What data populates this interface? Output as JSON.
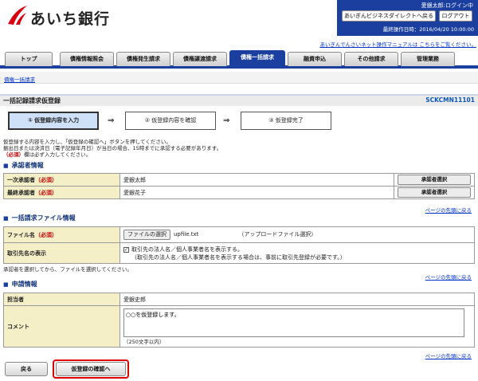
{
  "header": {
    "bank_name": "あいち銀行",
    "user_status": "愛銀太郎:ログイン中",
    "direct_button": "あいぎんビジネスダイレクトへ戻る",
    "logout_button": "ログアウト",
    "last_operation": "最終操作日時：2016/04/20 10:00:00",
    "manual_link": "あいぎんでんさいネット操作マニュアルは こちらをご覧ください。"
  },
  "tabs": [
    {
      "label": "トップ"
    },
    {
      "label": "債権情報照会"
    },
    {
      "label": "債権発生請求"
    },
    {
      "label": "債権譲渡請求"
    },
    {
      "label": "債権一括請求"
    },
    {
      "label": "融資申込"
    },
    {
      "label": "その他請求"
    },
    {
      "label": "管理業務"
    }
  ],
  "breadcrumb": "債権一括請求",
  "page": {
    "title": "一括記録請求仮登録",
    "screen_id": "SCKCMN11101"
  },
  "steps": [
    {
      "label": "① 仮登録内容を入力"
    },
    {
      "label": "② 仮登録内容を確認"
    },
    {
      "label": "③ 仮登録完了"
    }
  ],
  "arrow": "⇒",
  "intro": {
    "line1": "仮登録する内容を入力し、「仮登録の確認へ」ボタンを押してください。",
    "line2": "振出日または決済日（電子記録年月日）が当日の場合、15時までに承認する必要があります。",
    "line3_req": "（必須）",
    "line3_rest": "欄は必ず入力してください。"
  },
  "approver": {
    "heading": "承認者情報",
    "rows": [
      {
        "label": "一次承認者",
        "required": "（必須）",
        "value": "愛銀太郎",
        "button": "承認者選択"
      },
      {
        "label": "最終承認者",
        "required": "（必須）",
        "value": "愛銀花子",
        "button": "承認者選択"
      }
    ]
  },
  "page_top_link": "ページの先頭に戻る",
  "file": {
    "heading": "一括請求ファイル情報",
    "name_label": "ファイル名",
    "required": "（必須）",
    "choose_button": "ファイルの選択",
    "file_name": "upfile.txt",
    "upload_note": "（アップロードファイル選択）",
    "display_label": "取引先名の表示",
    "display_checkbox_label": "取引先の法人名／個人事業者名を表示する。",
    "display_note": "（取引先の法人名／個人事業者名を表示する場合は、事前に取引先登録が必要です。）",
    "after_note": "承認者を選択してから、ファイルを選択してください。"
  },
  "request": {
    "heading": "申請情報",
    "person_label": "担当者",
    "person_value": "愛銀史郎",
    "comment_label": "コメント",
    "comment_value": "○○を仮登録します。",
    "comment_limit": "（250文字以内）"
  },
  "buttons": {
    "back": "戻る",
    "confirm": "仮登録の確認へ"
  },
  "colors": {
    "brand_blue": "#1a3f9f",
    "logo_red": "#d7000f",
    "label_bg": "#f5efc8",
    "required_red": "#cc0000",
    "highlight_red": "#e00000"
  }
}
